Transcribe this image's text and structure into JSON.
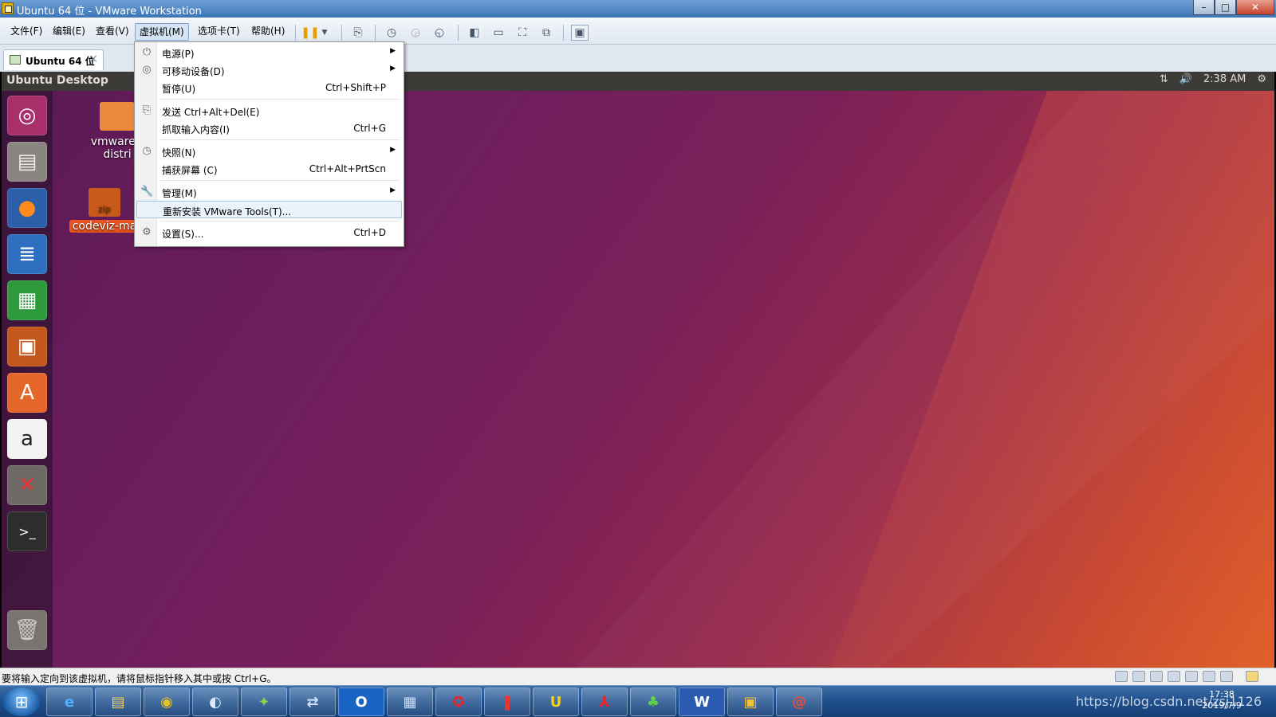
{
  "window": {
    "title": "Ubuntu 64 位 - VMware Workstation",
    "minimize": "–",
    "maximize": "□",
    "close": "✕"
  },
  "menubar": {
    "items": [
      "文件(F)",
      "编辑(E)",
      "查看(V)",
      "虚拟机(M)",
      "选项卡(T)",
      "帮助(H)"
    ],
    "active_index": 3
  },
  "toolbar": {
    "icons": [
      "pause-icon",
      "dropdown-arrow-icon",
      "send-ctrl-alt-del-icon",
      "snapshot-take-icon",
      "snapshot-revert-icon",
      "snapshot-manager-icon",
      "library-view-icon",
      "thumbnail-bar-icon",
      "fullscreen-icon",
      "unity-icon",
      "console-view-icon"
    ]
  },
  "tabs": [
    {
      "label": "Ubuntu 64 位",
      "close": "×"
    }
  ],
  "vm": {
    "topbar_title": "Ubuntu Desktop",
    "time": "2:38 AM",
    "desktop_icons": [
      {
        "label": "vmware-t distri",
        "line1": "vmware-t",
        "line2": "distri"
      },
      {
        "label": "codeviz-ma",
        "badge": "zip"
      }
    ],
    "launcher": [
      "ubuntu-dash-icon",
      "files-icon",
      "firefox-icon",
      "writer-icon",
      "calc-icon",
      "impress-icon",
      "software-center-icon",
      "amazon-icon",
      "system-settings-icon",
      "terminal-icon",
      "trash-icon"
    ]
  },
  "dropdown": {
    "items": [
      {
        "label": "电源(P)",
        "shortcut": "",
        "submenu": true,
        "icon": "power-icon"
      },
      {
        "label": "可移动设备(D)",
        "shortcut": "",
        "submenu": true,
        "icon": "disc-icon"
      },
      {
        "label": "暂停(U)",
        "shortcut": "Ctrl+Shift+P",
        "submenu": false,
        "icon": ""
      },
      {
        "label": "发送 Ctrl+Alt+Del(E)",
        "shortcut": "",
        "submenu": false,
        "icon": "send-keys-icon"
      },
      {
        "label": "抓取输入内容(I)",
        "shortcut": "Ctrl+G",
        "submenu": false,
        "icon": ""
      },
      {
        "label": "快照(N)",
        "shortcut": "",
        "submenu": true,
        "icon": "snapshot-icon"
      },
      {
        "label": "捕获屏幕 (C)",
        "shortcut": "Ctrl+Alt+PrtScn",
        "submenu": false,
        "icon": ""
      },
      {
        "label": "管理(M)",
        "shortcut": "",
        "submenu": true,
        "icon": "wrench-icon"
      },
      {
        "label": "重新安装 VMware Tools(T)...",
        "shortcut": "",
        "submenu": false,
        "icon": ""
      },
      {
        "label": "设置(S)...",
        "shortcut": "Ctrl+D",
        "submenu": false,
        "icon": "settings-icon"
      }
    ],
    "hovered_index": 8
  },
  "statusbar": {
    "text": "要将输入定向到该虚拟机，请将鼠标指针移入其中或按 Ctrl+G。"
  },
  "taskbar": {
    "apps": [
      "internet-explorer-icon",
      "file-explorer-icon",
      "chrome-icon",
      "browser-icon",
      "parrot-app-icon",
      "network-icon",
      "outlook-icon",
      "remote-desktop-icon",
      "red-app-icon",
      "bookmark-app-icon",
      "ultraedit-icon",
      "pdf-icon",
      "clover-icon",
      "word-icon",
      "vmware-icon",
      "snail-app-icon"
    ],
    "clock_time": "17:38",
    "clock_date": "2019/7/9",
    "watermark": "https://blog.csdn.net/zsj1126"
  }
}
